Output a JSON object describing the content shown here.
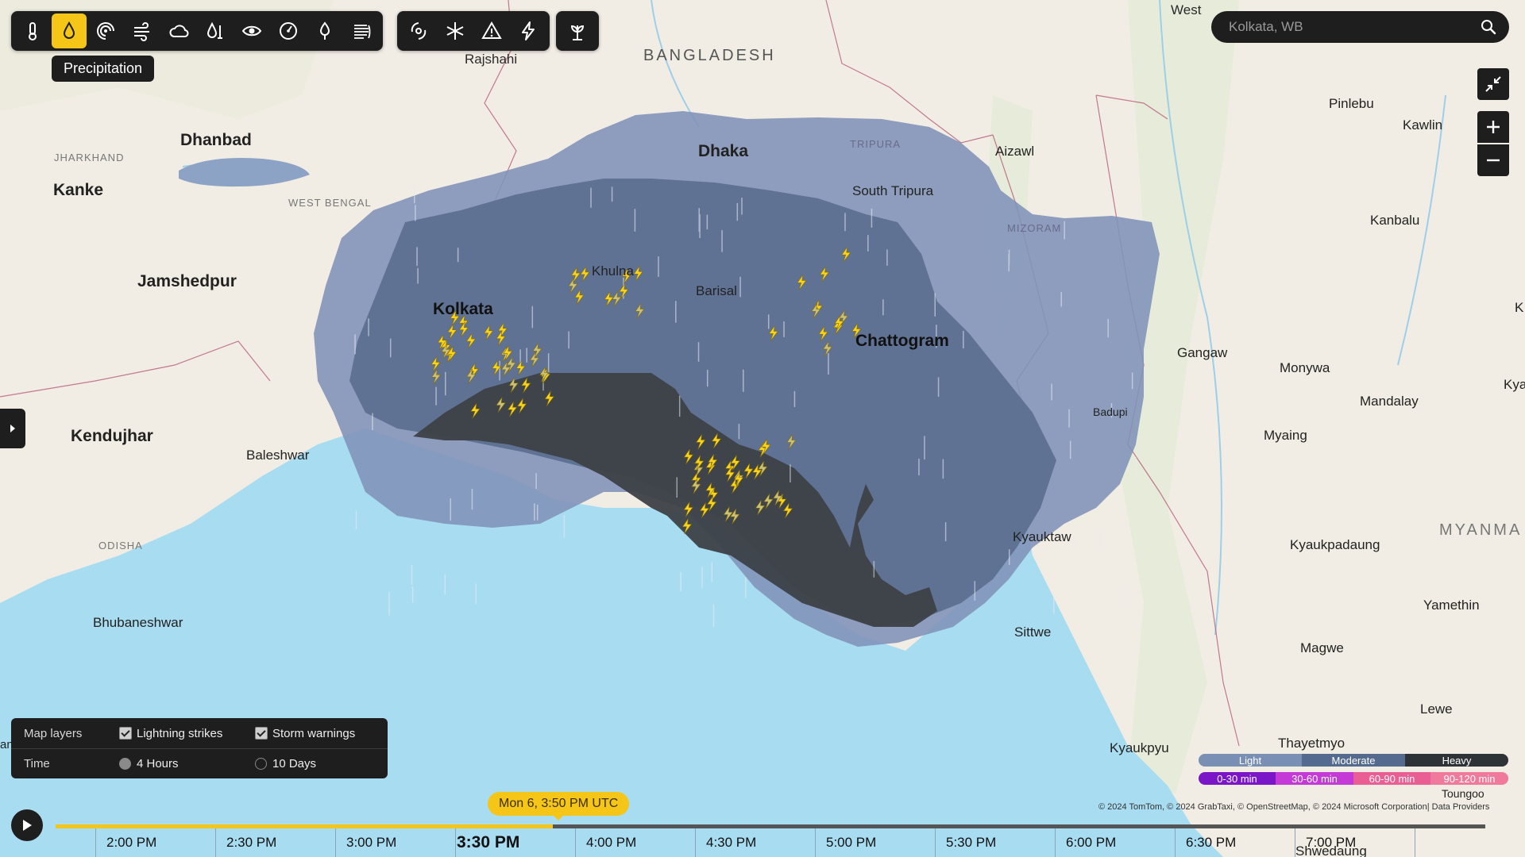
{
  "toolbar": {
    "group1": [
      {
        "name": "temperature-icon",
        "label": "Temperature"
      },
      {
        "name": "precipitation-icon",
        "label": "Precipitation",
        "active": true
      },
      {
        "name": "radar-icon",
        "label": "Radar"
      },
      {
        "name": "wind-icon",
        "label": "Wind"
      },
      {
        "name": "cloud-icon",
        "label": "Clouds"
      },
      {
        "name": "humidity-icon",
        "label": "Humidity"
      },
      {
        "name": "visibility-icon",
        "label": "Visibility"
      },
      {
        "name": "pressure-icon",
        "label": "Pressure"
      },
      {
        "name": "uv-icon",
        "label": "UV"
      },
      {
        "name": "air-quality-icon",
        "label": "Air quality"
      }
    ],
    "group2": [
      {
        "name": "hurricane-icon",
        "label": "Hurricanes"
      },
      {
        "name": "winter-icon",
        "label": "Winter"
      },
      {
        "name": "warning-icon",
        "label": "Warnings"
      },
      {
        "name": "lightning-icon",
        "label": "Lightning"
      }
    ],
    "group3": [
      {
        "name": "agriculture-icon",
        "label": "Agriculture"
      }
    ],
    "tooltip": "Precipitation"
  },
  "search": {
    "placeholder": "Kolkata, WB"
  },
  "map_controls": {
    "collapse": "collapse-icon",
    "zoom_in": "+",
    "zoom_out": "−"
  },
  "map_labels": {
    "countries": [
      "BANGLADESH",
      "MYANMA"
    ],
    "states": [
      "JHARKHAND",
      "WEST BENGAL",
      "TRIPURA",
      "MIZORAM",
      "ODISHA"
    ],
    "cities": [
      {
        "name": "West",
        "major": false
      },
      {
        "name": "Rajshahi",
        "major": false
      },
      {
        "name": "Dhanbad",
        "major": true
      },
      {
        "name": "Kanke",
        "major": true
      },
      {
        "name": "Dhaka",
        "major": true
      },
      {
        "name": "Aizawl",
        "major": false
      },
      {
        "name": "Pinlebu",
        "major": false
      },
      {
        "name": "Kawlin",
        "major": false
      },
      {
        "name": "South Tripura",
        "major": false
      },
      {
        "name": "Jamshedpur",
        "major": true
      },
      {
        "name": "Khulna",
        "major": false
      },
      {
        "name": "Kanbalu",
        "major": false
      },
      {
        "name": "Barisal",
        "major": false
      },
      {
        "name": "Kolkata",
        "major": true
      },
      {
        "name": "Chattogram",
        "major": true
      },
      {
        "name": "Gangaw",
        "major": false
      },
      {
        "name": "Monywa",
        "major": false
      },
      {
        "name": "Mandalay",
        "major": false
      },
      {
        "name": "Kya",
        "major": false
      },
      {
        "name": "Badupi",
        "major": false
      },
      {
        "name": "Kendujhar",
        "major": true
      },
      {
        "name": "Myaing",
        "major": false
      },
      {
        "name": "Baleshwar",
        "major": false
      },
      {
        "name": "Kyauktaw",
        "major": false
      },
      {
        "name": "Kyaukpadaung",
        "major": false
      },
      {
        "name": "Yamethin",
        "major": false
      },
      {
        "name": "Bhubaneshwar",
        "major": false
      },
      {
        "name": "Sittwe",
        "major": false
      },
      {
        "name": "Magwe",
        "major": false
      },
      {
        "name": "Lewe",
        "major": false
      },
      {
        "name": "Thayetmyo",
        "major": false
      },
      {
        "name": "Kyaukpyu",
        "major": false
      },
      {
        "name": "Toungoo",
        "major": false
      },
      {
        "name": "Shwedaung",
        "major": false
      },
      {
        "name": "K",
        "major": false
      },
      {
        "name": "an",
        "major": false
      }
    ]
  },
  "layers_panel": {
    "title": "Map layers",
    "lightning": {
      "label": "Lightning strikes",
      "checked": true
    },
    "storm": {
      "label": "Storm warnings",
      "checked": true
    },
    "time_label": "Time",
    "time_options": [
      {
        "label": "4 Hours",
        "selected": true
      },
      {
        "label": "10 Days",
        "selected": false
      }
    ]
  },
  "legend": {
    "intensity": [
      {
        "label": "Light",
        "color": "#7a8fb4"
      },
      {
        "label": "Moderate",
        "color": "#556a8f"
      },
      {
        "label": "Heavy",
        "color": "#2e3338"
      }
    ],
    "lightning_age": [
      {
        "label": "0-30 min",
        "color": "#7b16c8"
      },
      {
        "label": "30-60 min",
        "color": "#c43ad6"
      },
      {
        "label": "60-90 min",
        "color": "#ea5f93"
      },
      {
        "label": "90-120 min",
        "color": "#f07a9c"
      }
    ]
  },
  "attribution": "© 2024 TomTom, © 2024 GrabTaxi,  © OpenStreetMap, © 2024 Microsoft Corporation| Data Providers",
  "timeline": {
    "current_time": "Mon 6, 3:50 PM UTC",
    "progress_fraction": 0.348,
    "labels": [
      "2:00 PM",
      "2:30 PM",
      "3:00 PM",
      "3:30 PM",
      "4:00 PM",
      "4:30 PM",
      "5:00 PM",
      "5:30 PM",
      "6:00 PM",
      "6:30 PM",
      "7:00 PM"
    ],
    "current_label": "3:30 PM"
  },
  "colors": {
    "accent": "#f5c518",
    "panel": "#1e1e1e",
    "water": "#a8dcf0",
    "land": "#f2ede4",
    "rain_light": "#8597bb",
    "rain_moderate": "#5f7392",
    "rain_heavy": "#3a3f45"
  }
}
